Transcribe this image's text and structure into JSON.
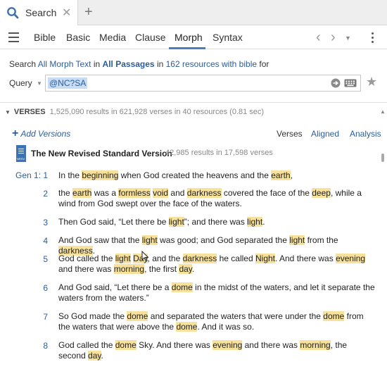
{
  "tab": {
    "title": "Search",
    "close": "✕",
    "new_tab": "+"
  },
  "menu": {
    "items": [
      "Bible",
      "Basic",
      "Media",
      "Clause",
      "Morph",
      "Syntax"
    ],
    "active": "Morph",
    "back": "‹",
    "forward": "›",
    "history_dropdown": "▼"
  },
  "search": {
    "prefix": "Search",
    "scope": "All Morph Text",
    "in1": "in",
    "passages": "All Passages",
    "in2": "in",
    "resources": "162 resources with bible",
    "suffix": "for"
  },
  "query": {
    "label": "Query",
    "dropdown": "▼",
    "value": "@NC?SA"
  },
  "results": {
    "toggle": "▼",
    "title": "VERSES",
    "summary": "1,525,090 results in 621,928 verses in 40 resources (0.81 sec)",
    "add_versions": "Add Versions",
    "view_tabs": [
      "Verses",
      "Aligned",
      "Analysis"
    ],
    "version_icon_tag": "NRSV",
    "version_title": "The New Revised Standard Version",
    "version_count": "42,985 results in 17,598 verses",
    "reference": "Gen 1:"
  },
  "verses": [
    {
      "num": "1",
      "parts": [
        [
          "In the ",
          false
        ],
        [
          "beginning",
          true
        ],
        [
          " when God created the heavens and the ",
          false
        ],
        [
          "earth",
          true
        ],
        [
          ",",
          false
        ]
      ]
    },
    {
      "num": "2",
      "parts": [
        [
          "the ",
          false
        ],
        [
          "earth",
          true
        ],
        [
          " was a ",
          false
        ],
        [
          "formless",
          true
        ],
        [
          " ",
          false
        ],
        [
          "void",
          true
        ],
        [
          " and ",
          false
        ],
        [
          "darkness",
          true
        ],
        [
          " covered the face of the ",
          false
        ],
        [
          "deep",
          true
        ],
        [
          ", while a wind from God swept over the face of the waters.",
          false
        ]
      ]
    },
    {
      "num": "3",
      "parts": [
        [
          "Then God said, “Let there be ",
          false
        ],
        [
          "light",
          true
        ],
        [
          "”; and there was ",
          false
        ],
        [
          "light",
          true
        ],
        [
          ".",
          false
        ]
      ]
    },
    {
      "num": "4",
      "parts": [
        [
          "And God saw that the ",
          false
        ],
        [
          "light",
          true
        ],
        [
          " was good; and God separated the ",
          false
        ],
        [
          "light",
          true
        ],
        [
          " from the ",
          false
        ],
        [
          "darkness",
          true
        ],
        [
          ".",
          false
        ]
      ]
    },
    {
      "num": "5",
      "parts": [
        [
          "God called the ",
          false
        ],
        [
          "light",
          true
        ],
        [
          " ",
          false
        ],
        [
          "Day",
          true
        ],
        [
          ", and the ",
          false
        ],
        [
          "darkness",
          true
        ],
        [
          " he called ",
          false
        ],
        [
          "Night",
          true
        ],
        [
          ". And there was ",
          false
        ],
        [
          "evening",
          true
        ],
        [
          " and there was ",
          false
        ],
        [
          "morning",
          true
        ],
        [
          ", the first ",
          false
        ],
        [
          "day",
          true
        ],
        [
          ".",
          false
        ]
      ]
    },
    {
      "num": "6",
      "parts": [
        [
          "And God said, “Let there be a ",
          false
        ],
        [
          "dome",
          true
        ],
        [
          " in the midst of the waters, and let it separate the waters from the waters.”",
          false
        ]
      ]
    },
    {
      "num": "7",
      "parts": [
        [
          "So God made the ",
          false
        ],
        [
          "dome",
          true
        ],
        [
          " and separated the waters that were under the ",
          false
        ],
        [
          "dome",
          true
        ],
        [
          " from the waters that were above the ",
          false
        ],
        [
          "dome",
          true
        ],
        [
          ". And it was so.",
          false
        ]
      ]
    },
    {
      "num": "8",
      "parts": [
        [
          "God called the ",
          false
        ],
        [
          "dome",
          true
        ],
        [
          " Sky. And there was ",
          false
        ],
        [
          "evening",
          true
        ],
        [
          " and there was ",
          false
        ],
        [
          "morning",
          true
        ],
        [
          ", the second ",
          false
        ],
        [
          "day",
          true
        ],
        [
          ".",
          false
        ]
      ]
    }
  ]
}
